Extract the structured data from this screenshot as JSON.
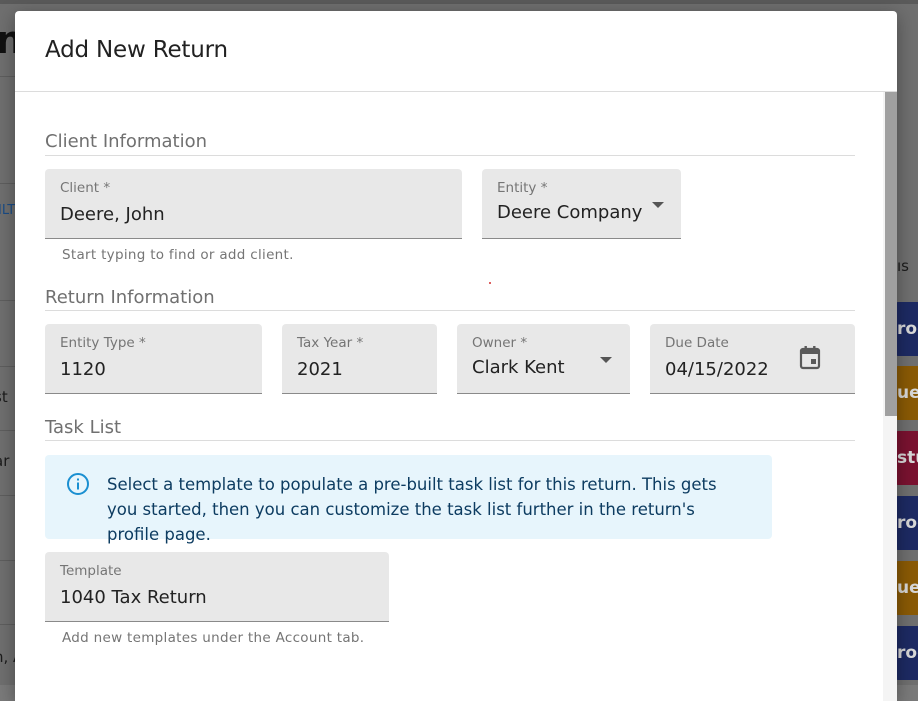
{
  "background": {
    "left_heading_fragment": "n",
    "left_link_fragment": "ILT",
    "left_row_fragments": [
      "t",
      "st",
      "ar",
      "n, A"
    ],
    "right_header_fragment": "ıs",
    "right_pills": [
      {
        "text": "rog",
        "color": "#1d2a63"
      },
      {
        "text": "ue",
        "color": "#8a5a05"
      },
      {
        "text": "stu",
        "color": "#7a1230"
      },
      {
        "text": "rog",
        "color": "#1d2a63"
      },
      {
        "text": "ue",
        "color": "#8a5a05"
      },
      {
        "text": "rog",
        "color": "#1d2a63"
      }
    ]
  },
  "dialog": {
    "title": "Add New Return",
    "client_section": {
      "title": "Client Information",
      "client": {
        "label": "Client *",
        "value": "Deere, John",
        "helper": "Start typing to find or add client."
      },
      "entity": {
        "label": "Entity *",
        "value": "Deere Company"
      }
    },
    "return_section": {
      "title": "Return Information",
      "entity_type": {
        "label": "Entity Type *",
        "value": "1120"
      },
      "tax_year": {
        "label": "Tax Year *",
        "value": "2021"
      },
      "owner": {
        "label": "Owner *",
        "value": "Clark Kent"
      },
      "due_date": {
        "label": "Due Date",
        "value": "04/15/2022"
      }
    },
    "task_section": {
      "title": "Task List",
      "info": "Select a template to populate a pre-built task list for this return. This gets you started, then you can customize the task list further in the return's profile page.",
      "template": {
        "label": "Template",
        "value": "1040 Tax Return",
        "helper": "Add new templates under the Account tab."
      }
    }
  },
  "colors": {
    "info_bg": "#e7f5fc",
    "info_icon": "#1a8fd1",
    "field_bg": "#e8e8e8"
  }
}
